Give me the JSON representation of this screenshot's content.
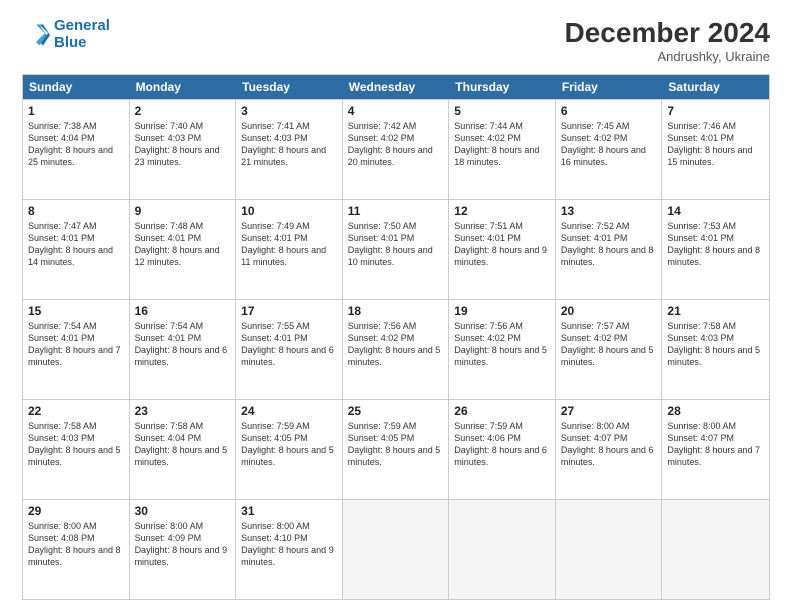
{
  "logo": {
    "line1": "General",
    "line2": "Blue"
  },
  "header": {
    "month": "December 2024",
    "location": "Andrushky, Ukraine"
  },
  "weekdays": [
    "Sunday",
    "Monday",
    "Tuesday",
    "Wednesday",
    "Thursday",
    "Friday",
    "Saturday"
  ],
  "rows": [
    [
      {
        "day": "1",
        "sunrise": "Sunrise: 7:38 AM",
        "sunset": "Sunset: 4:04 PM",
        "daylight": "Daylight: 8 hours and 25 minutes."
      },
      {
        "day": "2",
        "sunrise": "Sunrise: 7:40 AM",
        "sunset": "Sunset: 4:03 PM",
        "daylight": "Daylight: 8 hours and 23 minutes."
      },
      {
        "day": "3",
        "sunrise": "Sunrise: 7:41 AM",
        "sunset": "Sunset: 4:03 PM",
        "daylight": "Daylight: 8 hours and 21 minutes."
      },
      {
        "day": "4",
        "sunrise": "Sunrise: 7:42 AM",
        "sunset": "Sunset: 4:02 PM",
        "daylight": "Daylight: 8 hours and 20 minutes."
      },
      {
        "day": "5",
        "sunrise": "Sunrise: 7:44 AM",
        "sunset": "Sunset: 4:02 PM",
        "daylight": "Daylight: 8 hours and 18 minutes."
      },
      {
        "day": "6",
        "sunrise": "Sunrise: 7:45 AM",
        "sunset": "Sunset: 4:02 PM",
        "daylight": "Daylight: 8 hours and 16 minutes."
      },
      {
        "day": "7",
        "sunrise": "Sunrise: 7:46 AM",
        "sunset": "Sunset: 4:01 PM",
        "daylight": "Daylight: 8 hours and 15 minutes."
      }
    ],
    [
      {
        "day": "8",
        "sunrise": "Sunrise: 7:47 AM",
        "sunset": "Sunset: 4:01 PM",
        "daylight": "Daylight: 8 hours and 14 minutes."
      },
      {
        "day": "9",
        "sunrise": "Sunrise: 7:48 AM",
        "sunset": "Sunset: 4:01 PM",
        "daylight": "Daylight: 8 hours and 12 minutes."
      },
      {
        "day": "10",
        "sunrise": "Sunrise: 7:49 AM",
        "sunset": "Sunset: 4:01 PM",
        "daylight": "Daylight: 8 hours and 11 minutes."
      },
      {
        "day": "11",
        "sunrise": "Sunrise: 7:50 AM",
        "sunset": "Sunset: 4:01 PM",
        "daylight": "Daylight: 8 hours and 10 minutes."
      },
      {
        "day": "12",
        "sunrise": "Sunrise: 7:51 AM",
        "sunset": "Sunset: 4:01 PM",
        "daylight": "Daylight: 8 hours and 9 minutes."
      },
      {
        "day": "13",
        "sunrise": "Sunrise: 7:52 AM",
        "sunset": "Sunset: 4:01 PM",
        "daylight": "Daylight: 8 hours and 8 minutes."
      },
      {
        "day": "14",
        "sunrise": "Sunrise: 7:53 AM",
        "sunset": "Sunset: 4:01 PM",
        "daylight": "Daylight: 8 hours and 8 minutes."
      }
    ],
    [
      {
        "day": "15",
        "sunrise": "Sunrise: 7:54 AM",
        "sunset": "Sunset: 4:01 PM",
        "daylight": "Daylight: 8 hours and 7 minutes."
      },
      {
        "day": "16",
        "sunrise": "Sunrise: 7:54 AM",
        "sunset": "Sunset: 4:01 PM",
        "daylight": "Daylight: 8 hours and 6 minutes."
      },
      {
        "day": "17",
        "sunrise": "Sunrise: 7:55 AM",
        "sunset": "Sunset: 4:01 PM",
        "daylight": "Daylight: 8 hours and 6 minutes."
      },
      {
        "day": "18",
        "sunrise": "Sunrise: 7:56 AM",
        "sunset": "Sunset: 4:02 PM",
        "daylight": "Daylight: 8 hours and 5 minutes."
      },
      {
        "day": "19",
        "sunrise": "Sunrise: 7:56 AM",
        "sunset": "Sunset: 4:02 PM",
        "daylight": "Daylight: 8 hours and 5 minutes."
      },
      {
        "day": "20",
        "sunrise": "Sunrise: 7:57 AM",
        "sunset": "Sunset: 4:02 PM",
        "daylight": "Daylight: 8 hours and 5 minutes."
      },
      {
        "day": "21",
        "sunrise": "Sunrise: 7:58 AM",
        "sunset": "Sunset: 4:03 PM",
        "daylight": "Daylight: 8 hours and 5 minutes."
      }
    ],
    [
      {
        "day": "22",
        "sunrise": "Sunrise: 7:58 AM",
        "sunset": "Sunset: 4:03 PM",
        "daylight": "Daylight: 8 hours and 5 minutes."
      },
      {
        "day": "23",
        "sunrise": "Sunrise: 7:58 AM",
        "sunset": "Sunset: 4:04 PM",
        "daylight": "Daylight: 8 hours and 5 minutes."
      },
      {
        "day": "24",
        "sunrise": "Sunrise: 7:59 AM",
        "sunset": "Sunset: 4:05 PM",
        "daylight": "Daylight: 8 hours and 5 minutes."
      },
      {
        "day": "25",
        "sunrise": "Sunrise: 7:59 AM",
        "sunset": "Sunset: 4:05 PM",
        "daylight": "Daylight: 8 hours and 5 minutes."
      },
      {
        "day": "26",
        "sunrise": "Sunrise: 7:59 AM",
        "sunset": "Sunset: 4:06 PM",
        "daylight": "Daylight: 8 hours and 6 minutes."
      },
      {
        "day": "27",
        "sunrise": "Sunrise: 8:00 AM",
        "sunset": "Sunset: 4:07 PM",
        "daylight": "Daylight: 8 hours and 6 minutes."
      },
      {
        "day": "28",
        "sunrise": "Sunrise: 8:00 AM",
        "sunset": "Sunset: 4:07 PM",
        "daylight": "Daylight: 8 hours and 7 minutes."
      }
    ],
    [
      {
        "day": "29",
        "sunrise": "Sunrise: 8:00 AM",
        "sunset": "Sunset: 4:08 PM",
        "daylight": "Daylight: 8 hours and 8 minutes."
      },
      {
        "day": "30",
        "sunrise": "Sunrise: 8:00 AM",
        "sunset": "Sunset: 4:09 PM",
        "daylight": "Daylight: 8 hours and 9 minutes."
      },
      {
        "day": "31",
        "sunrise": "Sunrise: 8:00 AM",
        "sunset": "Sunset: 4:10 PM",
        "daylight": "Daylight: 8 hours and 9 minutes."
      },
      null,
      null,
      null,
      null
    ]
  ]
}
